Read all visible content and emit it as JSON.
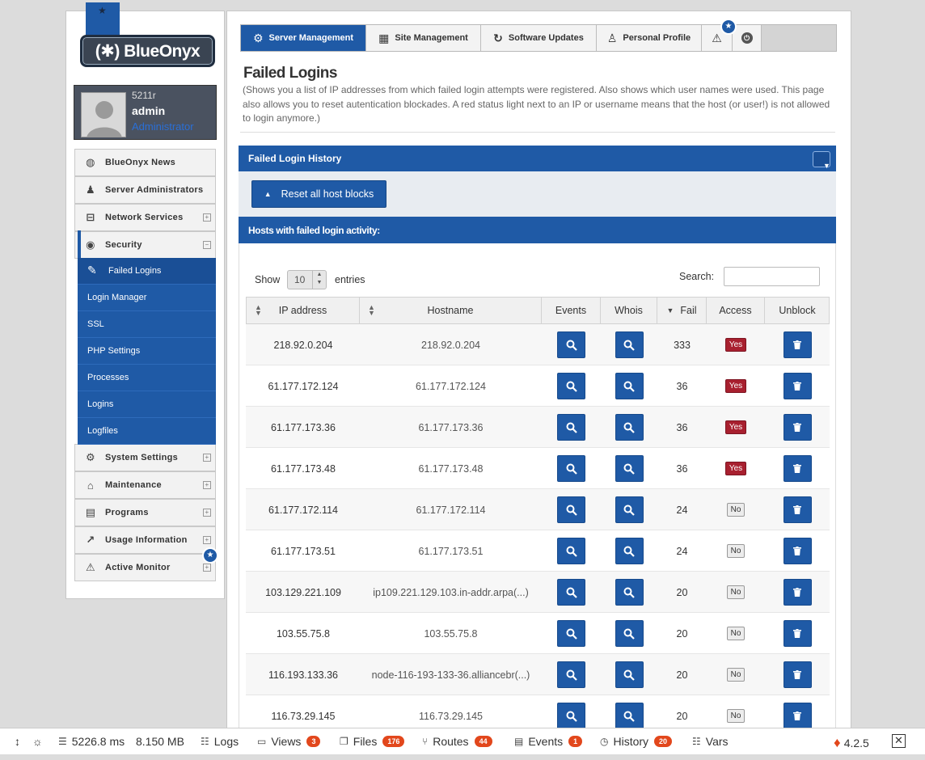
{
  "brand": {
    "logo_text": "(✱) BlueOnyx",
    "ribbon_icon": "star-icon"
  },
  "user": {
    "host": "5211r",
    "name": "admin",
    "role": "Administrator"
  },
  "sidebar": {
    "items": [
      {
        "label": "BlueOnyx News",
        "icon": "globe-icon"
      },
      {
        "label": "Server Administrators",
        "icon": "users-icon"
      },
      {
        "label": "Network Services",
        "icon": "network-icon",
        "toggle": "+"
      },
      {
        "label": "Security",
        "icon": "eye-icon",
        "toggle": "−"
      },
      {
        "label": "System Settings",
        "icon": "gear-icon",
        "toggle": "+"
      },
      {
        "label": "Maintenance",
        "icon": "toolbox-icon",
        "toggle": "+"
      },
      {
        "label": "Programs",
        "icon": "programs-icon",
        "toggle": "+"
      },
      {
        "label": "Usage Information",
        "icon": "chart-icon",
        "toggle": "+"
      },
      {
        "label": "Active Monitor",
        "icon": "warning-icon",
        "toggle": "+"
      }
    ],
    "security_sub": [
      {
        "label": "Failed Logins",
        "active": true
      },
      {
        "label": "Login Manager"
      },
      {
        "label": "SSL"
      },
      {
        "label": "PHP Settings"
      },
      {
        "label": "Processes"
      },
      {
        "label": "Logins"
      },
      {
        "label": "Logfiles"
      }
    ]
  },
  "topnav": {
    "tabs": [
      {
        "label": "Server Management",
        "icon": "gear-icon",
        "active": true
      },
      {
        "label": "Site Management",
        "icon": "layout-icon"
      },
      {
        "label": "Software Updates",
        "icon": "refresh-icon"
      },
      {
        "label": "Personal Profile",
        "icon": "person-icon"
      }
    ]
  },
  "page": {
    "title": "Failed Logins",
    "description": "(Shows you a list of IP addresses from which failed login attempts were registered. Also shows which user names were used. This page also allows you to reset autentication blockades. A red status light next to an IP or username means that the host (or user!) is not allowed to login anymore.)"
  },
  "box": {
    "title": "Failed Login History",
    "reset_label": "Reset all host blocks",
    "subheader": "Hosts with failed login activity:"
  },
  "table": {
    "show_label": "Show",
    "page_size": "10",
    "entries_label": "entries",
    "search_label": "Search:",
    "search_value": "",
    "columns": [
      "IP address",
      "Hostname",
      "Events",
      "Whois",
      "Fail",
      "Access",
      "Unblock"
    ],
    "rows": [
      {
        "ip": "218.92.0.204",
        "host": "218.92.0.204",
        "fail": "333",
        "access": "Yes"
      },
      {
        "ip": "61.177.172.124",
        "host": "61.177.172.124",
        "fail": "36",
        "access": "Yes"
      },
      {
        "ip": "61.177.173.36",
        "host": "61.177.173.36",
        "fail": "36",
        "access": "Yes"
      },
      {
        "ip": "61.177.173.48",
        "host": "61.177.173.48",
        "fail": "36",
        "access": "Yes"
      },
      {
        "ip": "61.177.172.114",
        "host": "61.177.172.114",
        "fail": "24",
        "access": "No"
      },
      {
        "ip": "61.177.173.51",
        "host": "61.177.173.51",
        "fail": "24",
        "access": "No"
      },
      {
        "ip": "103.129.221.109",
        "host": "ip109.221.129.103.in-addr.arpa(...)",
        "fail": "20",
        "access": "No"
      },
      {
        "ip": "103.55.75.8",
        "host": "103.55.75.8",
        "fail": "20",
        "access": "No"
      },
      {
        "ip": "116.193.133.36",
        "host": "node-116-193-133-36.alliancebr(...)",
        "fail": "20",
        "access": "No"
      },
      {
        "ip": "116.73.29.145",
        "host": "116.73.29.145",
        "fail": "20",
        "access": "No"
      }
    ]
  },
  "debugbar": {
    "time": "5226.8 ms",
    "memory": "8.150 MB",
    "items": [
      {
        "label": "Logs",
        "count": ""
      },
      {
        "label": "Views",
        "count": "3"
      },
      {
        "label": "Files",
        "count": "176"
      },
      {
        "label": "Routes",
        "count": "44"
      },
      {
        "label": "Events",
        "count": "1"
      },
      {
        "label": "History",
        "count": "20"
      },
      {
        "label": "Vars",
        "count": ""
      }
    ],
    "version": "4.2.5"
  },
  "colors": {
    "accent": "#1f5aa6",
    "danger": "#a8202f",
    "debug_badge": "#e2471c"
  }
}
